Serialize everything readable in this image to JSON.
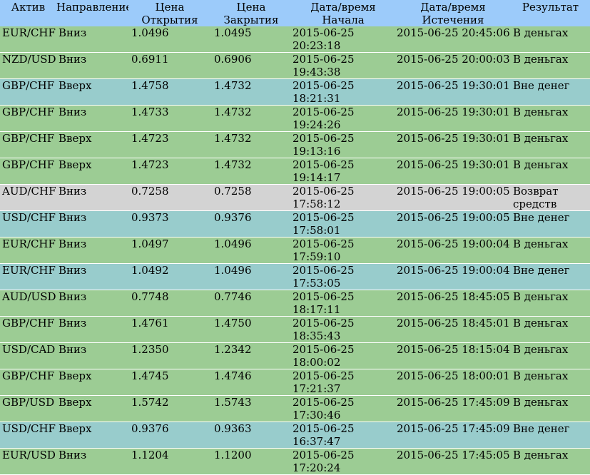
{
  "colors": {
    "header_bg": "#9ccbfa",
    "in_money_bg": "#9ccc94",
    "out_money_bg": "#98cccc",
    "refund_bg": "#d3d3d3"
  },
  "headers": {
    "asset": "Актив",
    "direction": "Направление",
    "open_price": "Цена Открытия",
    "close_price": "Цена Закрытия",
    "start_time": "Дата/время Начала",
    "expiry_time": "Дата/время Истечения",
    "result": "Результат"
  },
  "rows": [
    {
      "asset": "EUR/CHF",
      "direction": "Вниз",
      "open": "1.0496",
      "close": "1.0495",
      "start": "2015-06-25 20:23:18",
      "expiry": "2015-06-25 20:45:06",
      "result": "В деньгах",
      "status": "in"
    },
    {
      "asset": "NZD/USD",
      "direction": "Вниз",
      "open": "0.6911",
      "close": "0.6906",
      "start": "2015-06-25 19:43:38",
      "expiry": "2015-06-25 20:00:03",
      "result": "В деньгах",
      "status": "in"
    },
    {
      "asset": "GBP/CHF",
      "direction": "Вверх",
      "open": "1.4758",
      "close": "1.4732",
      "start": "2015-06-25 18:21:31",
      "expiry": "2015-06-25 19:30:01",
      "result": "Вне денег",
      "status": "out"
    },
    {
      "asset": "GBP/CHF",
      "direction": "Вниз",
      "open": "1.4733",
      "close": "1.4732",
      "start": "2015-06-25 19:24:26",
      "expiry": "2015-06-25 19:30:01",
      "result": "В деньгах",
      "status": "in"
    },
    {
      "asset": "GBP/CHF",
      "direction": "Вверх",
      "open": "1.4723",
      "close": "1.4732",
      "start": "2015-06-25 19:13:16",
      "expiry": "2015-06-25 19:30:01",
      "result": "В деньгах",
      "status": "in"
    },
    {
      "asset": "GBP/CHF",
      "direction": "Вверх",
      "open": "1.4723",
      "close": "1.4732",
      "start": "2015-06-25 19:14:17",
      "expiry": "2015-06-25 19:30:01",
      "result": "В деньгах",
      "status": "in"
    },
    {
      "asset": "AUD/CHF",
      "direction": "Вниз",
      "open": "0.7258",
      "close": "0.7258",
      "start": "2015-06-25 17:58:12",
      "expiry": "2015-06-25 19:00:05",
      "result": "Возврат средств",
      "status": "ref"
    },
    {
      "asset": "USD/CHF",
      "direction": "Вниз",
      "open": "0.9373",
      "close": "0.9376",
      "start": "2015-06-25 17:58:01",
      "expiry": "2015-06-25 19:00:05",
      "result": "Вне денег",
      "status": "out"
    },
    {
      "asset": "EUR/CHF",
      "direction": "Вниз",
      "open": "1.0497",
      "close": "1.0496",
      "start": "2015-06-25 17:59:10",
      "expiry": "2015-06-25 19:00:04",
      "result": "В деньгах",
      "status": "in"
    },
    {
      "asset": "EUR/CHF",
      "direction": "Вниз",
      "open": "1.0492",
      "close": "1.0496",
      "start": "2015-06-25 17:53:05",
      "expiry": "2015-06-25 19:00:04",
      "result": "Вне денег",
      "status": "out"
    },
    {
      "asset": "AUD/USD",
      "direction": "Вниз",
      "open": "0.7748",
      "close": "0.7746",
      "start": "2015-06-25 18:17:11",
      "expiry": "2015-06-25 18:45:05",
      "result": "В деньгах",
      "status": "in"
    },
    {
      "asset": "GBP/CHF",
      "direction": "Вниз",
      "open": "1.4761",
      "close": "1.4750",
      "start": "2015-06-25 18:35:43",
      "expiry": "2015-06-25 18:45:01",
      "result": "В деньгах",
      "status": "in"
    },
    {
      "asset": "USD/CAD",
      "direction": "Вниз",
      "open": "1.2350",
      "close": "1.2342",
      "start": "2015-06-25 18:00:02",
      "expiry": "2015-06-25 18:15:04",
      "result": "В деньгах",
      "status": "in"
    },
    {
      "asset": "GBP/CHF",
      "direction": "Вверх",
      "open": "1.4745",
      "close": "1.4746",
      "start": "2015-06-25 17:21:37",
      "expiry": "2015-06-25 18:00:01",
      "result": "В деньгах",
      "status": "in"
    },
    {
      "asset": "GBP/USD",
      "direction": "Вверх",
      "open": "1.5742",
      "close": "1.5743",
      "start": "2015-06-25 17:30:46",
      "expiry": "2015-06-25 17:45:09",
      "result": "В деньгах",
      "status": "in"
    },
    {
      "asset": "USD/CHF",
      "direction": "Вверх",
      "open": "0.9376",
      "close": "0.9363",
      "start": "2015-06-25 16:37:47",
      "expiry": "2015-06-25 17:45:09",
      "result": "Вне денег",
      "status": "out"
    },
    {
      "asset": "EUR/USD",
      "direction": "Вниз",
      "open": "1.1204",
      "close": "1.1200",
      "start": "2015-06-25 17:20:24",
      "expiry": "2015-06-25 17:45:05",
      "result": "В деньгах",
      "status": "in"
    }
  ]
}
